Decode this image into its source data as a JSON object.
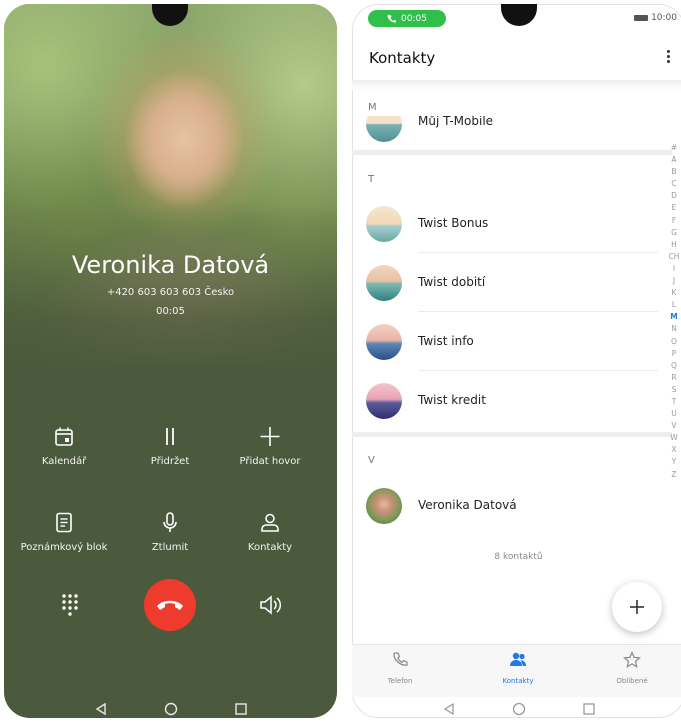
{
  "call": {
    "name": "Veronika Datová",
    "number": "+420 603 603 603   Česko",
    "timer": "00:05",
    "actions": [
      {
        "label": "Kalendář",
        "icon": "calendar-icon"
      },
      {
        "label": "Přidržet",
        "icon": "pause-icon"
      },
      {
        "label": "Přidat hovor",
        "icon": "plus-icon"
      },
      {
        "label": "Poznámkový blok",
        "icon": "notepad-icon"
      },
      {
        "label": "Ztlumit",
        "icon": "microphone-icon"
      },
      {
        "label": "Kontakty",
        "icon": "person-icon"
      }
    ],
    "end_call_color": "#ef3b2e"
  },
  "contacts": {
    "status_time": "00:05",
    "clock": "10:00",
    "title": "Kontakty",
    "sections": [
      {
        "letter": "M",
        "items": [
          {
            "name": "Můj T-Mobile"
          }
        ]
      },
      {
        "letter": "T",
        "items": [
          {
            "name": "Twist Bonus"
          },
          {
            "name": "Twist dobití"
          },
          {
            "name": "Twist info"
          },
          {
            "name": "Twist kredit"
          }
        ]
      },
      {
        "letter": "V",
        "items": [
          {
            "name": "Veronika Datová"
          }
        ]
      }
    ],
    "index": [
      "#",
      "A",
      "B",
      "C",
      "D",
      "E",
      "F",
      "G",
      "H",
      "CH",
      "I",
      "J",
      "K",
      "L",
      "M",
      "N",
      "O",
      "P",
      "Q",
      "R",
      "S",
      "T",
      "U",
      "V",
      "W",
      "X",
      "Y",
      "Z"
    ],
    "active_index": "M",
    "count": "8 kontaktů",
    "tabs": [
      {
        "label": "Telefon",
        "icon": "phone-icon"
      },
      {
        "label": "Kontakty",
        "icon": "contacts-icon"
      },
      {
        "label": "Oblíbené",
        "icon": "star-icon"
      }
    ],
    "accent": "#1e7be6"
  }
}
